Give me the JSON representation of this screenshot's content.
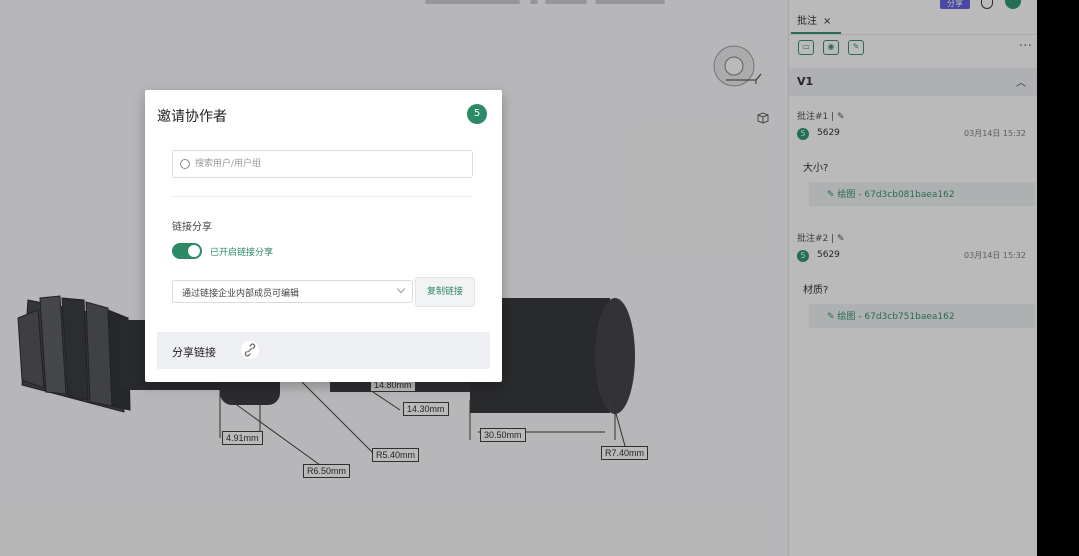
{
  "topbar": {
    "share_label": "分享"
  },
  "dimensions": [
    "14.80mm",
    "14.30mm",
    "30.50mm",
    "4.91mm",
    "R5.40mm",
    "R6.50mm",
    "R7.40mm"
  ],
  "panel": {
    "tab_label": "批注",
    "tab_close": "×",
    "more": "···",
    "version": "V1",
    "annotations": [
      {
        "label": "批注#1",
        "avatar": "5",
        "user": "5629",
        "time": "03月14日 15:32",
        "text": "大小?",
        "link": "绘图 - 67d3cb081baea162"
      },
      {
        "label": "批注#2",
        "avatar": "5",
        "user": "5629",
        "time": "03月14日 15:32",
        "text": "材质?",
        "link": "绘图 - 67d3cb751baea162"
      }
    ]
  },
  "dialog": {
    "title": "邀请协作者",
    "badge": "5",
    "search_placeholder": "搜索用户/用户组",
    "link_share_label": "链接分享",
    "toggle_label": "已开启链接分享",
    "toggle_on": true,
    "permission_value": "通过链接企业内部成员可编辑",
    "copy_button": "复制链接",
    "share_link_label": "分享链接"
  },
  "colors": {
    "accent": "#2d8a66",
    "share_button": "#5b57d9"
  }
}
